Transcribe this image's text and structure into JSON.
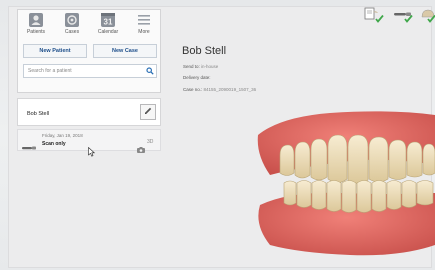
{
  "nav": {
    "items": [
      {
        "label": "Patients",
        "icon": "patients-icon"
      },
      {
        "label": "Cases",
        "icon": "cases-icon"
      },
      {
        "label": "Calendar",
        "icon": "calendar-icon",
        "day": "31"
      },
      {
        "label": "More",
        "icon": "more-icon"
      }
    ]
  },
  "actions": {
    "new_patient": "New Patient",
    "new_case": "New Case"
  },
  "search": {
    "placeholder": "Search for a patient"
  },
  "patient_list": {
    "selected_name": "Bob Stell"
  },
  "case": {
    "date": "Friday, Jan 19, 2018",
    "title": "Scan only",
    "badge_3d": "3D"
  },
  "patient_details": {
    "name": "Bob Stell",
    "send_to_label": "Send to:",
    "send_to_value": "in-house",
    "delivery_label": "Delivery date:",
    "delivery_value": "",
    "case_no_label": "Case no.:",
    "case_no_value": "84155_2090019_1507_36"
  },
  "colors": {
    "accent": "#1d4e8a",
    "search_icon": "#2a6fb5",
    "check": "#3fa74a",
    "gum": "#e46a62",
    "tooth": "#efe0bc"
  }
}
